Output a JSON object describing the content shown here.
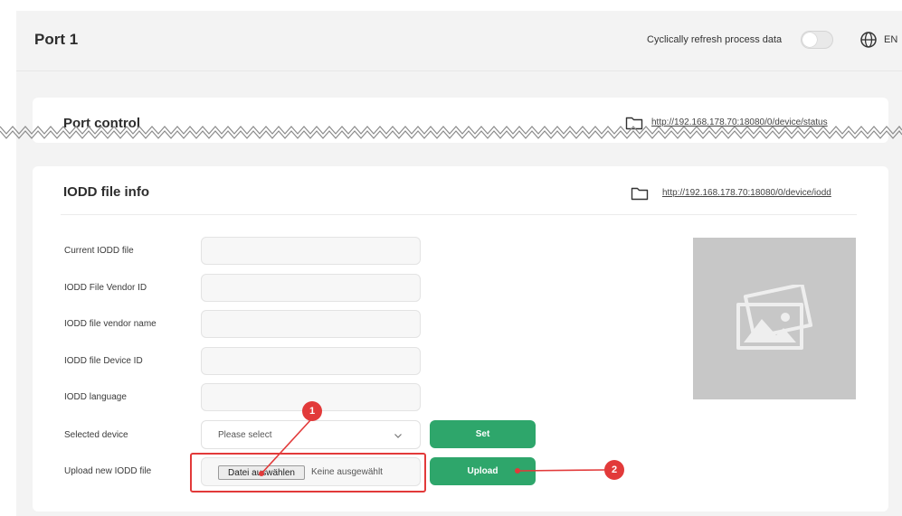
{
  "header": {
    "title": "Port 1",
    "refresh_label": "Cyclically refresh process data",
    "refresh_on": false,
    "language": "EN"
  },
  "port_control": {
    "title": "Port control",
    "link": "http://192.168.178.70:18080/0/device/status"
  },
  "iodd": {
    "title": "IODD file info",
    "link": "http://192.168.178.70:18080/0/device/iodd",
    "fields": [
      {
        "label": "Current IODD file",
        "value": ""
      },
      {
        "label": "IODD File Vendor ID",
        "value": ""
      },
      {
        "label": "IODD file vendor name",
        "value": ""
      },
      {
        "label": "IODD file Device ID",
        "value": ""
      },
      {
        "label": "IODD language",
        "value": ""
      }
    ],
    "selected_device_label": "Selected device",
    "selected_device_placeholder": "Please select",
    "set_label": "Set",
    "upload_label_text": "Upload new IODD file",
    "file_button": "Datei auswählen",
    "file_status": "Keine ausgewählt",
    "upload_button": "Upload"
  },
  "annotations": {
    "badge_1": "1",
    "badge_2": "2",
    "accent": "#e23a3a"
  },
  "colors": {
    "primary_button": "#2ea66b",
    "page_bg": "#f3f3f3",
    "card_bg": "#ffffff"
  }
}
